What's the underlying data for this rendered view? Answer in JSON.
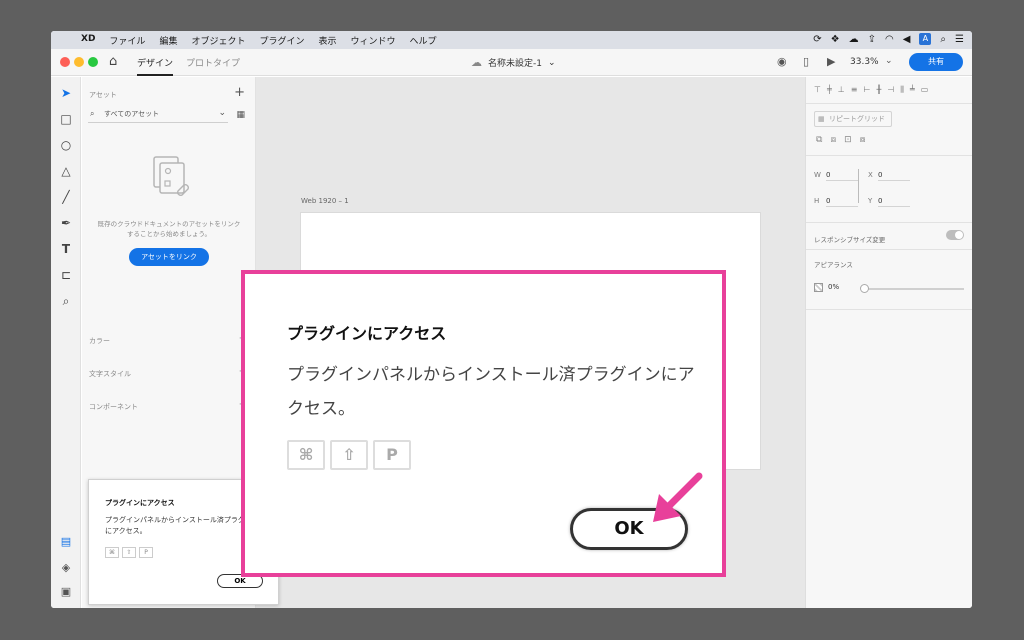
{
  "menubar": {
    "app": "XD",
    "items": [
      "ファイル",
      "編集",
      "オブジェクト",
      "プラグイン",
      "表示",
      "ウィンドウ",
      "ヘルプ"
    ],
    "input_badge": "A"
  },
  "toolbar": {
    "tab_design": "デザイン",
    "tab_prototype": "プロトタイプ",
    "document_title": "名称未設定-1",
    "zoom": "33.3%",
    "share_label": "共有"
  },
  "assets": {
    "title": "アセット",
    "search_placeholder": "すべてのアセット",
    "empty_message": "既存のクラウドドキュメントのアセットをリンクすることから始めましょう。",
    "link_button": "アセットをリンク",
    "sections": [
      "カラー",
      "文字スタイル",
      "コンポーネント"
    ]
  },
  "canvas": {
    "artboard_label": "Web 1920 – 1"
  },
  "inspector": {
    "repeat_grid": "リピートグリッド",
    "w_label": "W",
    "w_value": "0",
    "h_label": "H",
    "h_value": "0",
    "x_label": "X",
    "x_value": "0",
    "y_label": "Y",
    "y_value": "0",
    "responsive_label": "レスポンシブサイズ変更",
    "appearance_label": "アピアランス",
    "opacity": "0%"
  },
  "dialog": {
    "title": "プラグインにアクセス",
    "body": "プラグインパネルからインストール済プラグインにアクセス。",
    "keys": [
      "⌘",
      "⇧",
      "P"
    ],
    "ok_label": "OK"
  },
  "colors": {
    "accent": "#1473e6",
    "highlight": "#e8409a"
  }
}
